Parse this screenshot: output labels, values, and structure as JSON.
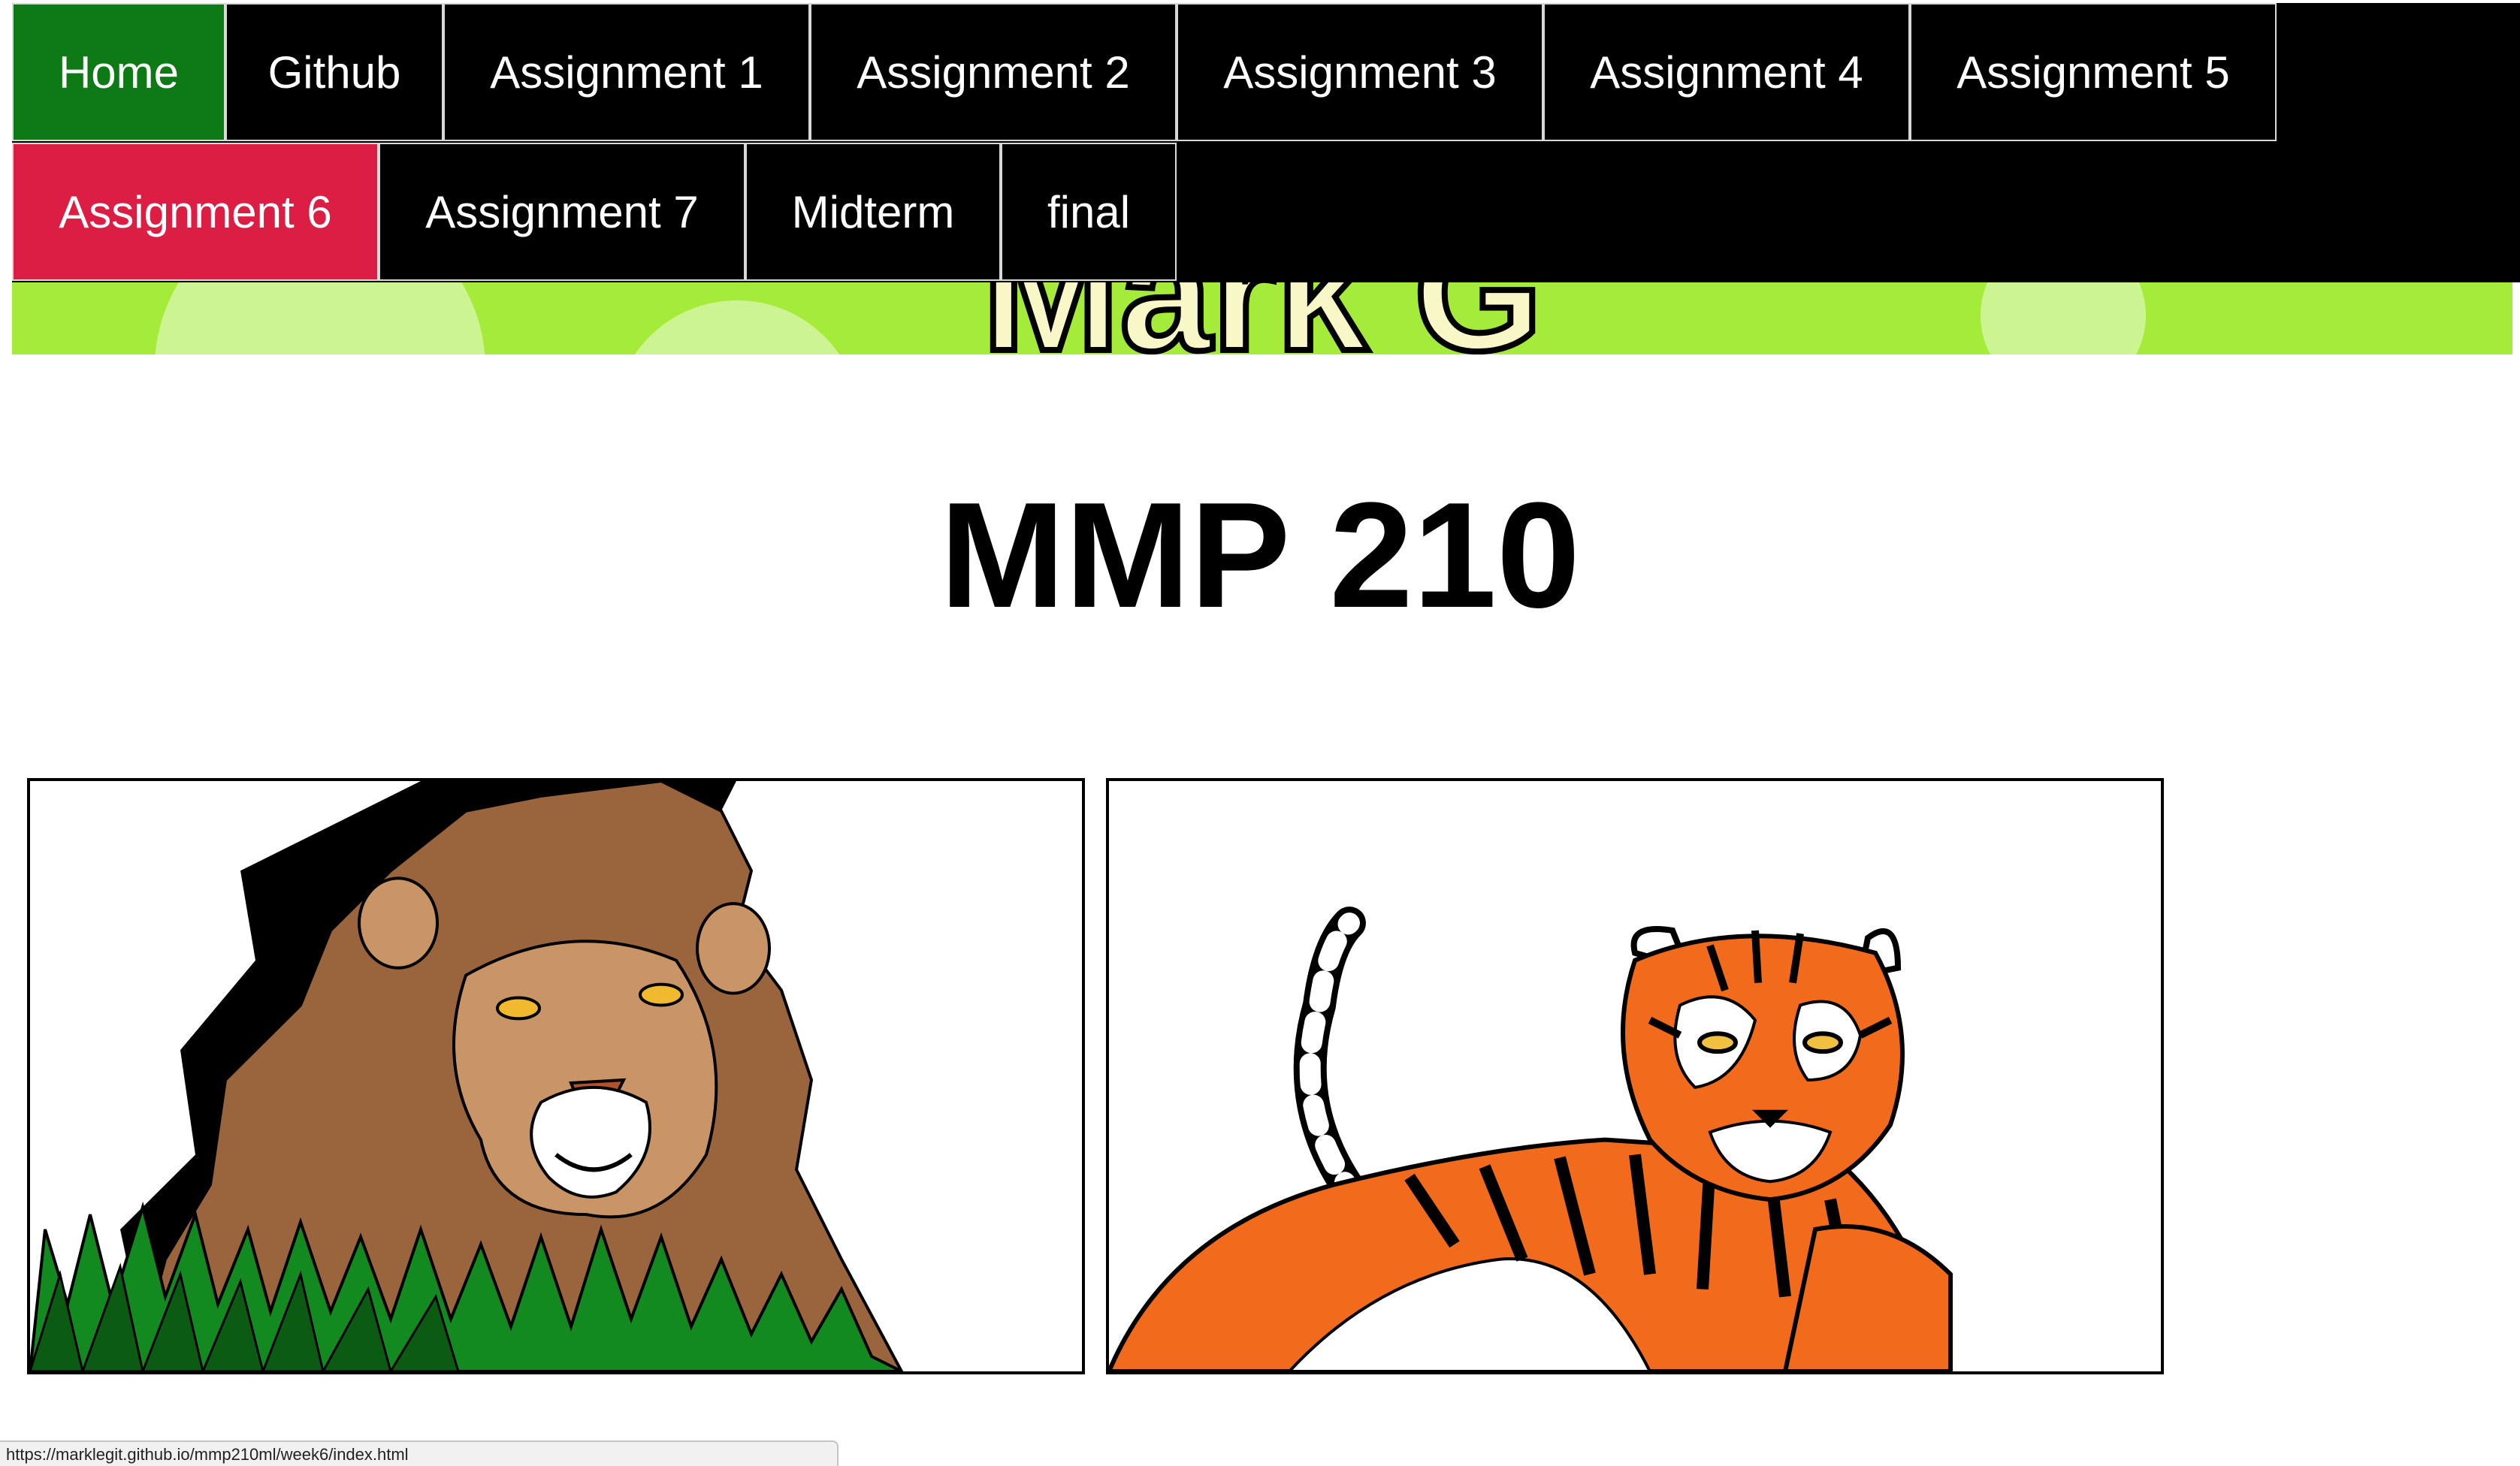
{
  "nav": {
    "row1": [
      {
        "label": "Home"
      },
      {
        "label": "Github"
      },
      {
        "label": "Assignment 1"
      },
      {
        "label": "Assignment 2"
      },
      {
        "label": "Assignment 3"
      },
      {
        "label": "Assignment 4"
      },
      {
        "label": "Assignment 5"
      }
    ],
    "row2": [
      {
        "label": "Assignment 6"
      },
      {
        "label": "Assignment 7"
      },
      {
        "label": "Midterm"
      },
      {
        "label": "final"
      }
    ],
    "colors": {
      "bar": "#000000",
      "home": "#0e7a15",
      "active": "#dc1e45",
      "text": "#ffffff"
    }
  },
  "banner": {
    "title": "Mark G",
    "color": "#a5ec3a"
  },
  "main": {
    "heading": "MMP 210"
  },
  "gallery": {
    "images": [
      {
        "subject": "lion illustration"
      },
      {
        "subject": "tiger illustration"
      }
    ]
  },
  "status_bar": {
    "url": "https://marklegit.github.io/mmp210ml/week6/index.html"
  }
}
